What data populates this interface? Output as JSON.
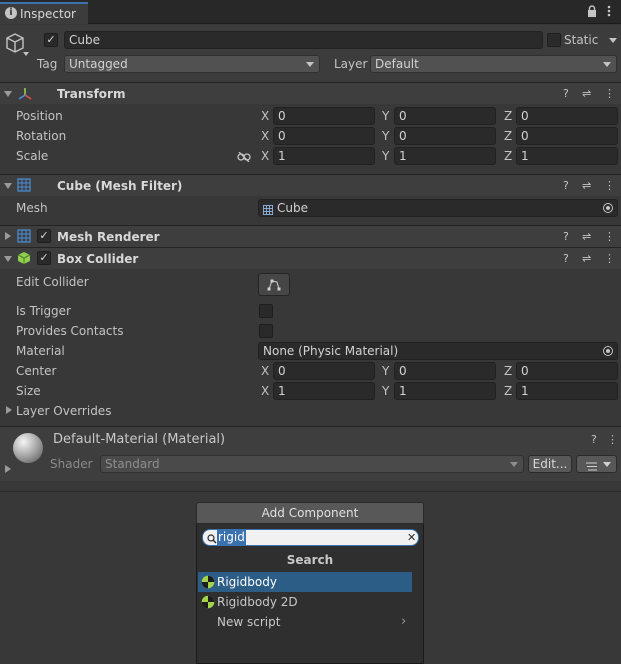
{
  "tab": {
    "label": "Inspector"
  },
  "object": {
    "active": "✓",
    "name": "Cube",
    "static_label": "Static",
    "tag_label": "Tag",
    "tag_value": "Untagged",
    "layer_label": "Layer",
    "layer_value": "Default"
  },
  "transform": {
    "title": "Transform",
    "rows": [
      {
        "label": "Position",
        "x": "0",
        "y": "0",
        "z": "0"
      },
      {
        "label": "Rotation",
        "x": "0",
        "y": "0",
        "z": "0"
      },
      {
        "label": "Scale",
        "x": "1",
        "y": "1",
        "z": "1"
      }
    ]
  },
  "axes": {
    "x": "X",
    "y": "Y",
    "z": "Z"
  },
  "mesh_filter": {
    "title": "Cube (Mesh Filter)",
    "mesh_label": "Mesh",
    "mesh_value": "Cube"
  },
  "mesh_renderer": {
    "title": "Mesh Renderer",
    "enabled": "✓"
  },
  "box_collider": {
    "title": "Box Collider",
    "enabled": "✓",
    "edit_collider_label": "Edit Collider",
    "is_trigger_label": "Is Trigger",
    "provides_contacts_label": "Provides Contacts",
    "material_label": "Material",
    "material_value": "None (Physic Material)",
    "center_label": "Center",
    "center": {
      "x": "0",
      "y": "0",
      "z": "0"
    },
    "size_label": "Size",
    "size": {
      "x": "1",
      "y": "1",
      "z": "1"
    },
    "layer_overrides_label": "Layer Overrides"
  },
  "material": {
    "name": "Default-Material (Material)",
    "shader_label": "Shader",
    "shader_value": "Standard",
    "edit_label": "Edit..."
  },
  "add_component": {
    "button_label": "Add Component",
    "search_value": "rigid",
    "search_header": "Search",
    "results": [
      {
        "label": "Rigidbody",
        "selected": true
      },
      {
        "label": "Rigidbody 2D",
        "selected": false
      },
      {
        "label": "New script",
        "selected": false
      }
    ]
  },
  "colors": {
    "selected_row": "#2c5d87",
    "accent_blue": "#4c8ed9",
    "rigidbody_icon": "#a4d34a"
  }
}
